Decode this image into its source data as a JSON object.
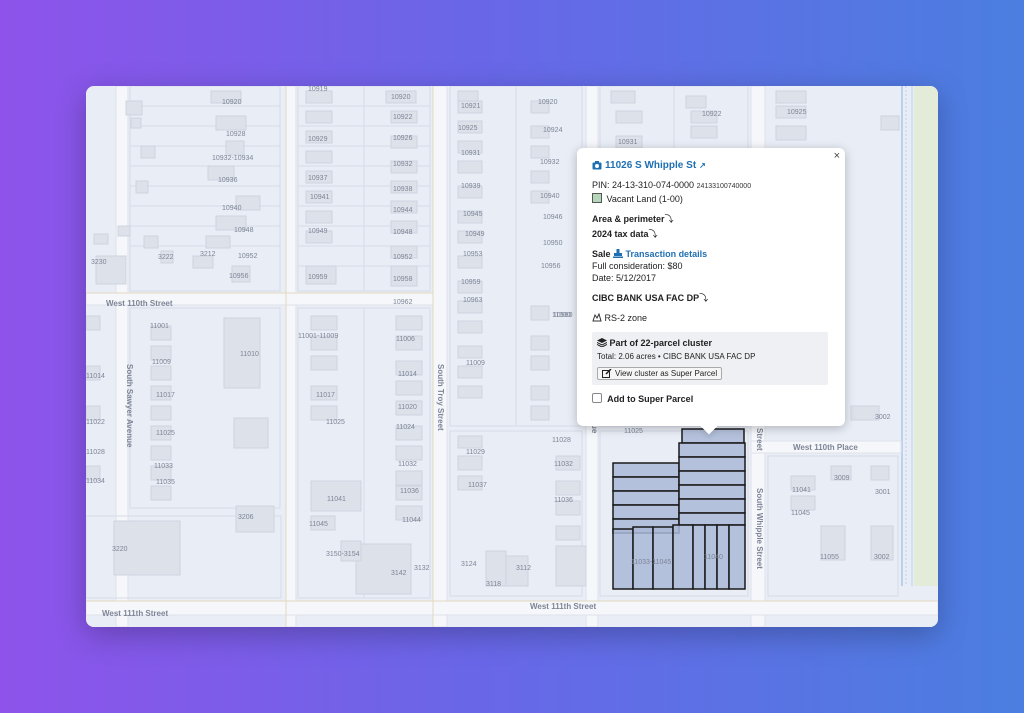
{
  "map": {
    "streets": {
      "west_110th_street": "West 110th Street",
      "west_111th_street_left": "West 111th Street",
      "west_111th_street_mid": "West 111th Street",
      "west_110th_place": "West 110th Place",
      "south_sawyer_avenue": "South Sawyer Avenue",
      "south_troy_street": "South Troy Street",
      "south_whipple_street": "South Whipple Street",
      "south_whipple_street_top": "Street",
      "avenue_fragment": "ue"
    },
    "address_labels": [
      {
        "text": "10920"
      },
      {
        "text": "10928"
      },
      {
        "text": "10932-10934"
      },
      {
        "text": "10936"
      },
      {
        "text": "10940"
      },
      {
        "text": "10948"
      },
      {
        "text": "10952"
      },
      {
        "text": "10956"
      },
      {
        "text": "3230"
      },
      {
        "text": "3222"
      },
      {
        "text": "3212"
      },
      {
        "text": "10919"
      },
      {
        "text": "10929"
      },
      {
        "text": "10937"
      },
      {
        "text": "10941"
      },
      {
        "text": "10949"
      },
      {
        "text": "10959"
      },
      {
        "text": "10920"
      },
      {
        "text": "10922"
      },
      {
        "text": "10926"
      },
      {
        "text": "10932"
      },
      {
        "text": "10938"
      },
      {
        "text": "10944"
      },
      {
        "text": "10948"
      },
      {
        "text": "10952"
      },
      {
        "text": "10958"
      },
      {
        "text": "10962"
      },
      {
        "text": "10921"
      },
      {
        "text": "10925"
      },
      {
        "text": "10931"
      },
      {
        "text": "10939"
      },
      {
        "text": "10945"
      },
      {
        "text": "10949"
      },
      {
        "text": "10953"
      },
      {
        "text": "10959"
      },
      {
        "text": "10963"
      },
      {
        "text": "10920"
      },
      {
        "text": "10924"
      },
      {
        "text": "10932"
      },
      {
        "text": "10940"
      },
      {
        "text": "10946"
      },
      {
        "text": "10950"
      },
      {
        "text": "10956"
      },
      {
        "text": "10960"
      },
      {
        "text": "10931"
      },
      {
        "text": "10925"
      },
      {
        "text": "10922"
      },
      {
        "text": "11001"
      },
      {
        "text": "11009"
      },
      {
        "text": "11017"
      },
      {
        "text": "11025"
      },
      {
        "text": "11033"
      },
      {
        "text": "11035"
      },
      {
        "text": "11010"
      },
      {
        "text": "11014"
      },
      {
        "text": "11022"
      },
      {
        "text": "11028"
      },
      {
        "text": "11034"
      },
      {
        "text": "11001-11009"
      },
      {
        "text": "11017"
      },
      {
        "text": "11025"
      },
      {
        "text": "11006"
      },
      {
        "text": "11014"
      },
      {
        "text": "11020"
      },
      {
        "text": "11024"
      },
      {
        "text": "11032"
      },
      {
        "text": "11036"
      },
      {
        "text": "11044"
      },
      {
        "text": "11041"
      },
      {
        "text": "11045"
      },
      {
        "text": "11009"
      },
      {
        "text": "11029"
      },
      {
        "text": "11037"
      },
      {
        "text": "11000"
      },
      {
        "text": "11032"
      },
      {
        "text": "11036"
      },
      {
        "text": "11028"
      },
      {
        "text": "11025"
      },
      {
        "text": "3206"
      },
      {
        "text": "3220"
      },
      {
        "text": "3150-3154"
      },
      {
        "text": "3142"
      },
      {
        "text": "3132"
      },
      {
        "text": "3124"
      },
      {
        "text": "3118"
      },
      {
        "text": "3112"
      },
      {
        "text": "11041"
      },
      {
        "text": "11045"
      },
      {
        "text": "11055"
      },
      {
        "text": "3009"
      },
      {
        "text": "3001"
      },
      {
        "text": "3002"
      },
      {
        "text": "3002"
      },
      {
        "text": "11033-11045"
      },
      {
        "text": "11040"
      }
    ]
  },
  "popup": {
    "address": "11026 S Whipple St",
    "pin_label": "PIN: 24-13-310-074-0000",
    "pin_raw": "24133100740000",
    "land_use": "Vacant Land (1-00)",
    "area_perimeter": "Area & perimeter",
    "tax_data": "2024 tax data",
    "sale_label": "Sale",
    "transaction_details": "Transaction details",
    "full_consideration": "Full consideration: $80",
    "date": "Date: 5/12/2017",
    "owner": "CIBC BANK USA FAC DP",
    "zone": "RS-2 zone",
    "cluster_title": "Part of 22-parcel cluster",
    "cluster_total": "Total: 2.06 acres • CIBC BANK USA FAC DP",
    "view_cluster_button": "View cluster as Super Parcel",
    "add_to_super_parcel": "Add to Super Parcel",
    "close": "×",
    "arrow_glyph": "⤵",
    "ext_glyph": "↗"
  },
  "colors": {
    "link": "#1f6fb3",
    "cluster_fill": "#aab9d7",
    "cluster_stroke": "#1a1a1a",
    "land_use_swatch": "#b5d7b9"
  }
}
